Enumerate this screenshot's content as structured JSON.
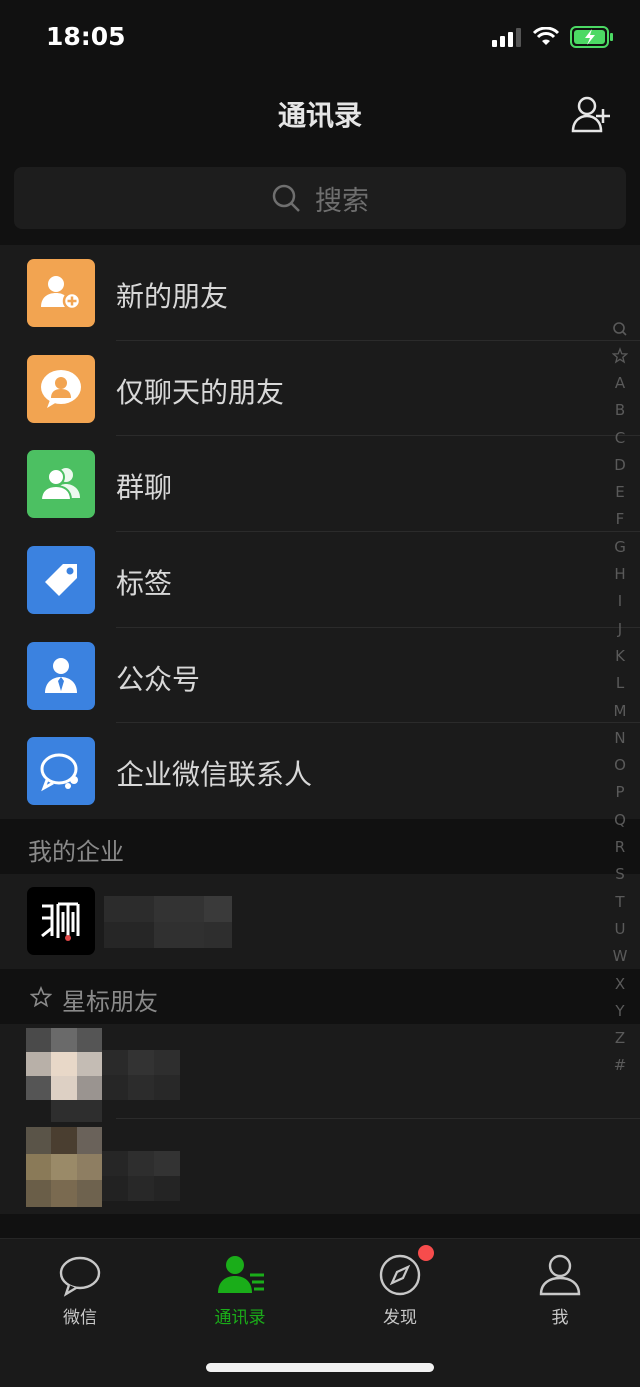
{
  "status_bar": {
    "time": "18:05"
  },
  "nav": {
    "title": "通讯录"
  },
  "search": {
    "placeholder": "搜索"
  },
  "top_items": [
    {
      "label": "新的朋友",
      "icon": "add-friend-icon",
      "color": "#f2a451"
    },
    {
      "label": "仅聊天的朋友",
      "icon": "chat-only-icon",
      "color": "#f2a451"
    },
    {
      "label": "群聊",
      "icon": "group-chat-icon",
      "color": "#4cc062"
    },
    {
      "label": "标签",
      "icon": "tag-icon",
      "color": "#3b82e0"
    },
    {
      "label": "公众号",
      "icon": "official-account-icon",
      "color": "#3b82e0"
    },
    {
      "label": "企业微信联系人",
      "icon": "wecom-contact-icon",
      "color": "#3b82e0"
    }
  ],
  "sections": {
    "my_enterprise": "我的企业",
    "starred_friends": "星标朋友"
  },
  "index_letters": [
    "A",
    "B",
    "C",
    "D",
    "E",
    "F",
    "G",
    "H",
    "I",
    "J",
    "K",
    "L",
    "M",
    "N",
    "O",
    "P",
    "Q",
    "R",
    "S",
    "T",
    "U",
    "W",
    "X",
    "Y",
    "Z",
    "#"
  ],
  "tabs": [
    {
      "label": "微信",
      "icon": "chat-bubble-icon",
      "active": false
    },
    {
      "label": "通讯录",
      "icon": "contacts-icon",
      "active": true
    },
    {
      "label": "发现",
      "icon": "compass-icon",
      "active": false,
      "badge": true
    },
    {
      "label": "我",
      "icon": "person-icon",
      "active": false
    }
  ],
  "colors": {
    "active_tab": "#1aad19",
    "badge": "#f74c4c",
    "battery": "#4cd964"
  }
}
